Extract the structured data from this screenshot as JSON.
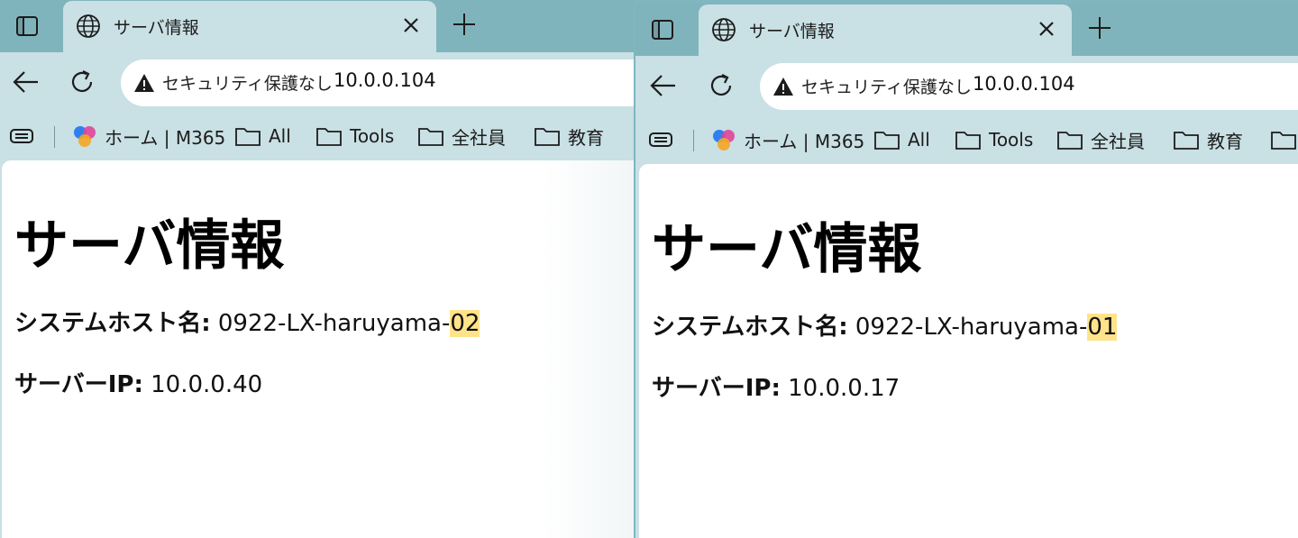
{
  "windows": [
    {
      "tab_title": "サーバ情報",
      "address": {
        "security_label": "セキュリティ保護なし",
        "url": "10.0.0.104"
      },
      "bookmarks": [
        "ホーム | M365",
        "All",
        "Tools",
        "全社員",
        "教育"
      ],
      "page": {
        "heading": "サーバ情報",
        "hostname_label": "システムホスト名:",
        "hostname_prefix": "0922-LX-haruyama-",
        "hostname_suffix": "02",
        "ip_label": "サーバーIP:",
        "ip_value": "10.0.0.40"
      }
    },
    {
      "tab_title": "サーバ情報",
      "address": {
        "security_label": "セキュリティ保護なし",
        "url": "10.0.0.104"
      },
      "bookmarks": [
        "ホーム | M365",
        "All",
        "Tools",
        "全社員",
        "教育"
      ],
      "page": {
        "heading": "サーバ情報",
        "hostname_label": "システムホスト名:",
        "hostname_prefix": "0922-LX-haruyama-",
        "hostname_suffix": "01",
        "ip_label": "サーバーIP:",
        "ip_value": "10.0.0.17"
      }
    }
  ],
  "colors": {
    "tabstrip": "#80b4bd",
    "chrome": "#c9e0e4",
    "highlight": "#ffe38a"
  }
}
